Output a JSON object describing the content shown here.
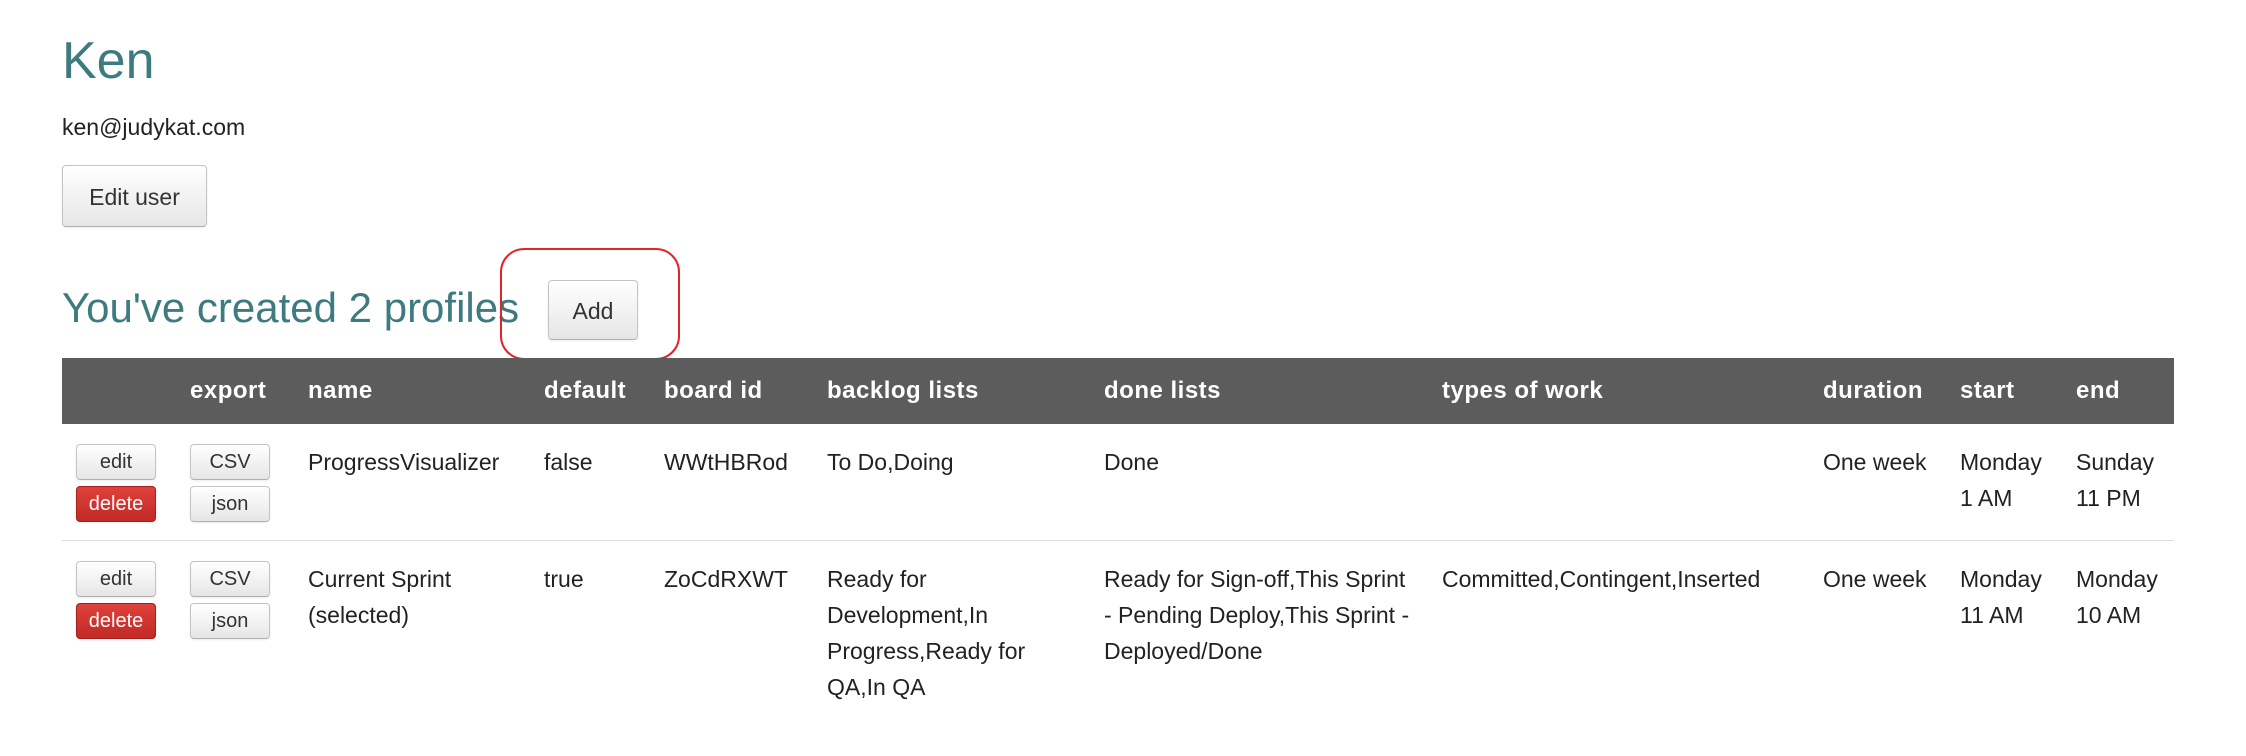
{
  "user": {
    "name": "Ken",
    "email": "ken@judykat.com",
    "edit_label": "Edit user"
  },
  "profiles_section": {
    "heading": "You've created 2 profiles",
    "add_label": "Add"
  },
  "table": {
    "headers": [
      "",
      "export",
      "name",
      "default",
      "board id",
      "backlog lists",
      "done lists",
      "types of work",
      "duration",
      "start",
      "end"
    ],
    "edit_label": "edit",
    "delete_label": "delete",
    "csv_label": "CSV",
    "json_label": "json",
    "rows": [
      {
        "name": "ProgressVisualizer",
        "default": "false",
        "board_id": "WWtHBRod",
        "backlog_lists": "To Do,Doing",
        "done_lists": "Done",
        "types_of_work": "",
        "duration": "One week",
        "start": "Monday 1 AM",
        "end": "Sunday 11 PM"
      },
      {
        "name": "Current Sprint (selected)",
        "default": "true",
        "board_id": "ZoCdRXWT",
        "backlog_lists": "Ready for Development,In Progress,Ready for QA,In QA",
        "done_lists": "Ready for Sign-off,This Sprint - Pending Deploy,This Sprint - Deployed/Done",
        "types_of_work": "Committed,Contingent,Inserted",
        "duration": "One week",
        "start": "Monday 11 AM",
        "end": "Monday 10 AM"
      }
    ]
  },
  "colors": {
    "heading": "#3d7b80",
    "table_header_bg": "#5c5c5c",
    "delete_button": "#d9342f",
    "highlight_annotation": "#e0242a"
  }
}
